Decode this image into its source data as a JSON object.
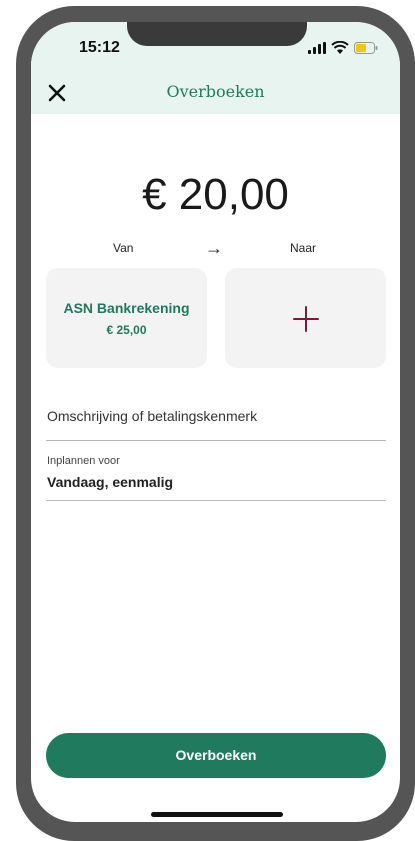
{
  "status_bar": {
    "time": "15:12",
    "icons": [
      "signal-icon",
      "wifi-icon",
      "battery-icon"
    ]
  },
  "header": {
    "close_icon": "close-icon",
    "title": "Overboeken"
  },
  "amount": "€ 20,00",
  "transfer": {
    "from_label": "Van",
    "arrow": "→",
    "to_label": "Naar",
    "from_account": {
      "name": "ASN Bankrekening",
      "balance": "€ 25,00"
    },
    "to_account": {
      "icon": "plus-icon"
    }
  },
  "description": {
    "placeholder": "Omschrijving of betalingskenmerk"
  },
  "schedule": {
    "label": "Inplannen voor",
    "value": "Vandaag, eenmalig"
  },
  "submit": {
    "label": "Overboeken"
  },
  "colors": {
    "brand_green": "#1f7a5e",
    "header_bg": "#e8f4ef",
    "plus_color": "#7a1a3a",
    "card_bg": "#f3f3f3",
    "battery_fill": "#f5c518"
  }
}
